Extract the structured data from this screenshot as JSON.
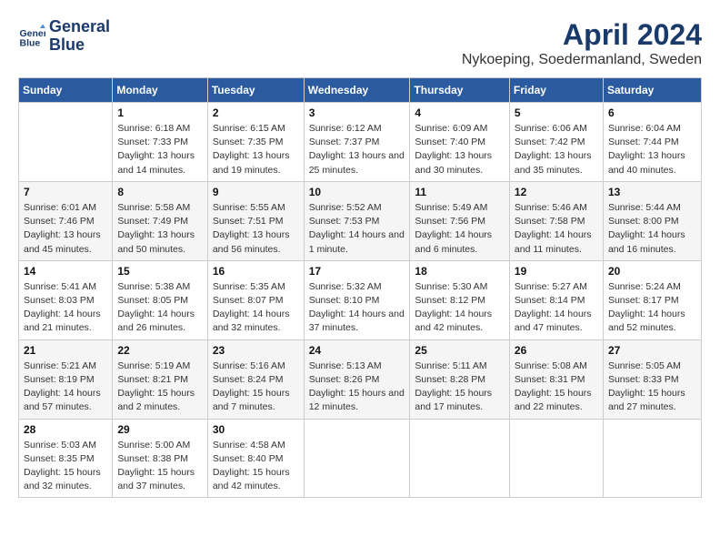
{
  "header": {
    "logo_line1": "General",
    "logo_line2": "Blue",
    "month_year": "April 2024",
    "location": "Nykoeping, Soedermanland, Sweden"
  },
  "weekdays": [
    "Sunday",
    "Monday",
    "Tuesday",
    "Wednesday",
    "Thursday",
    "Friday",
    "Saturday"
  ],
  "weeks": [
    [
      {
        "day": "",
        "sunrise": "",
        "sunset": "",
        "daylight": ""
      },
      {
        "day": "1",
        "sunrise": "6:18 AM",
        "sunset": "7:33 PM",
        "daylight": "13 hours and 14 minutes."
      },
      {
        "day": "2",
        "sunrise": "6:15 AM",
        "sunset": "7:35 PM",
        "daylight": "13 hours and 19 minutes."
      },
      {
        "day": "3",
        "sunrise": "6:12 AM",
        "sunset": "7:37 PM",
        "daylight": "13 hours and 25 minutes."
      },
      {
        "day": "4",
        "sunrise": "6:09 AM",
        "sunset": "7:40 PM",
        "daylight": "13 hours and 30 minutes."
      },
      {
        "day": "5",
        "sunrise": "6:06 AM",
        "sunset": "7:42 PM",
        "daylight": "13 hours and 35 minutes."
      },
      {
        "day": "6",
        "sunrise": "6:04 AM",
        "sunset": "7:44 PM",
        "daylight": "13 hours and 40 minutes."
      }
    ],
    [
      {
        "day": "7",
        "sunrise": "6:01 AM",
        "sunset": "7:46 PM",
        "daylight": "13 hours and 45 minutes."
      },
      {
        "day": "8",
        "sunrise": "5:58 AM",
        "sunset": "7:49 PM",
        "daylight": "13 hours and 50 minutes."
      },
      {
        "day": "9",
        "sunrise": "5:55 AM",
        "sunset": "7:51 PM",
        "daylight": "13 hours and 56 minutes."
      },
      {
        "day": "10",
        "sunrise": "5:52 AM",
        "sunset": "7:53 PM",
        "daylight": "14 hours and 1 minute."
      },
      {
        "day": "11",
        "sunrise": "5:49 AM",
        "sunset": "7:56 PM",
        "daylight": "14 hours and 6 minutes."
      },
      {
        "day": "12",
        "sunrise": "5:46 AM",
        "sunset": "7:58 PM",
        "daylight": "14 hours and 11 minutes."
      },
      {
        "day": "13",
        "sunrise": "5:44 AM",
        "sunset": "8:00 PM",
        "daylight": "14 hours and 16 minutes."
      }
    ],
    [
      {
        "day": "14",
        "sunrise": "5:41 AM",
        "sunset": "8:03 PM",
        "daylight": "14 hours and 21 minutes."
      },
      {
        "day": "15",
        "sunrise": "5:38 AM",
        "sunset": "8:05 PM",
        "daylight": "14 hours and 26 minutes."
      },
      {
        "day": "16",
        "sunrise": "5:35 AM",
        "sunset": "8:07 PM",
        "daylight": "14 hours and 32 minutes."
      },
      {
        "day": "17",
        "sunrise": "5:32 AM",
        "sunset": "8:10 PM",
        "daylight": "14 hours and 37 minutes."
      },
      {
        "day": "18",
        "sunrise": "5:30 AM",
        "sunset": "8:12 PM",
        "daylight": "14 hours and 42 minutes."
      },
      {
        "day": "19",
        "sunrise": "5:27 AM",
        "sunset": "8:14 PM",
        "daylight": "14 hours and 47 minutes."
      },
      {
        "day": "20",
        "sunrise": "5:24 AM",
        "sunset": "8:17 PM",
        "daylight": "14 hours and 52 minutes."
      }
    ],
    [
      {
        "day": "21",
        "sunrise": "5:21 AM",
        "sunset": "8:19 PM",
        "daylight": "14 hours and 57 minutes."
      },
      {
        "day": "22",
        "sunrise": "5:19 AM",
        "sunset": "8:21 PM",
        "daylight": "15 hours and 2 minutes."
      },
      {
        "day": "23",
        "sunrise": "5:16 AM",
        "sunset": "8:24 PM",
        "daylight": "15 hours and 7 minutes."
      },
      {
        "day": "24",
        "sunrise": "5:13 AM",
        "sunset": "8:26 PM",
        "daylight": "15 hours and 12 minutes."
      },
      {
        "day": "25",
        "sunrise": "5:11 AM",
        "sunset": "8:28 PM",
        "daylight": "15 hours and 17 minutes."
      },
      {
        "day": "26",
        "sunrise": "5:08 AM",
        "sunset": "8:31 PM",
        "daylight": "15 hours and 22 minutes."
      },
      {
        "day": "27",
        "sunrise": "5:05 AM",
        "sunset": "8:33 PM",
        "daylight": "15 hours and 27 minutes."
      }
    ],
    [
      {
        "day": "28",
        "sunrise": "5:03 AM",
        "sunset": "8:35 PM",
        "daylight": "15 hours and 32 minutes."
      },
      {
        "day": "29",
        "sunrise": "5:00 AM",
        "sunset": "8:38 PM",
        "daylight": "15 hours and 37 minutes."
      },
      {
        "day": "30",
        "sunrise": "4:58 AM",
        "sunset": "8:40 PM",
        "daylight": "15 hours and 42 minutes."
      },
      {
        "day": "",
        "sunrise": "",
        "sunset": "",
        "daylight": ""
      },
      {
        "day": "",
        "sunrise": "",
        "sunset": "",
        "daylight": ""
      },
      {
        "day": "",
        "sunrise": "",
        "sunset": "",
        "daylight": ""
      },
      {
        "day": "",
        "sunrise": "",
        "sunset": "",
        "daylight": ""
      }
    ]
  ],
  "labels": {
    "sunrise_prefix": "Sunrise: ",
    "sunset_prefix": "Sunset: ",
    "daylight_prefix": "Daylight: "
  }
}
